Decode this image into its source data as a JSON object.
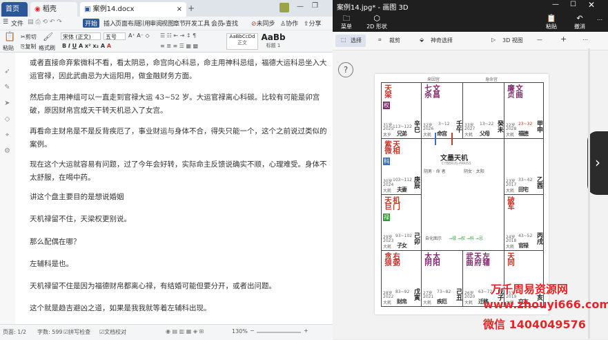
{
  "wps": {
    "tabs": [
      {
        "label": "首页"
      },
      {
        "label": "稻壳"
      },
      {
        "label": "案例14.docx"
      }
    ],
    "menus": [
      "文件",
      "开始",
      "插入",
      "页面布局",
      "引用",
      "审阅",
      "视图",
      "章节",
      "开发工具"
    ],
    "menu_more": "会员",
    "search_label": "查找",
    "sync_label": "未同步",
    "collab_label": "协作",
    "share_label": "分享",
    "ribbon": {
      "paste": "粘贴",
      "cut": "剪切",
      "copy": "复制",
      "format_painter": "格式刷",
      "font_name": "宋体 (正文)",
      "font_size": "五号",
      "style_normal_preview": "AaBbCcDd",
      "style_normal": "正文",
      "style_heading_preview": "AaBb",
      "style_heading": "标题 1"
    },
    "paragraphs": [
      "或者直接命弃紫微科不看，看太阴忌，命宫向心科忌，命主用神科忌组，福德大运科忌坐入大运官禄，因此武曲忌为大运阳用，做金融财务方面。",
      "然后命主用神组可以一直走到官禄大运 43~52 岁。大运官禄离心科碳。比较有可能是卯宫破，原因财帛宫成天干转天机忌入了女宫。",
      "再看命主财帛是不是反背疾厄了，事业财运与身体不合，得失只能一个，这个之前说过类似的案例。",
      "现在这个大运就容易有问题，过了今年会好转，实际命主反馈说确实不顺，心理难受。身体不太舒服，在喝中药。",
      "讲这个盘主要目的是想说婚姻",
      "天机禄留不住，天梁权更别说。",
      "那么配偶在哪？",
      "左辅科是也。",
      "天机禄留不住是因为福德财帛都离心禄，有结婚可能但要分开，或者出问题。",
      "这个就是趋吉避凶之道，如果是我我就等着左辅科出现。"
    ],
    "status": {
      "page": "页面: 1/2",
      "words": "字数: 599",
      "spell": "拼写检查",
      "proof": "文档校对",
      "zoom": "130%"
    }
  },
  "paint3d": {
    "title": "案例14.jpg* - 画图 3D",
    "toolbar": {
      "menu": "菜单",
      "shapes": "2D 形状",
      "paste": "粘贴",
      "undo": "撤消"
    },
    "subtools": {
      "select": "选择",
      "crop": "裁剪",
      "magic_select": "神奇选择",
      "view_3d": "3D 视图"
    },
    "help_label": "?",
    "chart": {
      "top_left_label": "来因宫",
      "top_right_label": "身命宫",
      "center_title": "文墨天机",
      "center_subtitle": "CYBERUS-PARISS",
      "center_info_left": "阴男 · 命 者",
      "center_info_right": "阴女 · 太阳",
      "flying_line": "自化图示",
      "flying_legend": "→禄 →权 →科 →忌",
      "palaces": [
        {
          "stars": [
            "天梁"
          ],
          "hua": "权",
          "hua_color": "#7d2a6a",
          "age": "31岁",
          "year": "2025",
          "range": "113~122",
          "name": "兄弟",
          "gan": "辛巳",
          "sub": "太岁"
        },
        {
          "stars": [
            "七杀",
            "文昌"
          ],
          "hua": "",
          "hua_color": "",
          "age": "32岁",
          "year": "2026",
          "range": "3~12",
          "name": "命宫",
          "gan": "壬午",
          "sub": "大耗"
        },
        {
          "stars": [],
          "hua": "",
          "hua_color": "",
          "age": "33岁",
          "year": "2027",
          "range": "13~22",
          "name": "父母",
          "gan": "癸未",
          "sub": "大耗"
        },
        {
          "stars": [
            "廉贞",
            "文曲"
          ],
          "hua": "",
          "hua_color": "",
          "age": "22岁",
          "year": "2028",
          "range": "23~32",
          "name": "福德",
          "gan": "甲申",
          "sub": "大耗"
        },
        {
          "stars": [
            "紫微",
            "天相"
          ],
          "hua": "科",
          "hua_color": "#3a6fb5",
          "age": "30岁",
          "year": "2024",
          "range": "103~112",
          "name": "夫妻",
          "gan": "庚辰",
          "sub": "大耗"
        },
        {
          "stars": [],
          "hua": "",
          "hua_color": "",
          "age": "23岁",
          "year": "2017",
          "range": "33~42",
          "name": "田宅",
          "gan": "乙酉",
          "sub": "大耗"
        },
        {
          "stars": [
            "天巨",
            "机门"
          ],
          "hua": "禄",
          "hua_color": "#2e9b3e",
          "age": "29岁",
          "year": "2023",
          "range": "93~102",
          "name": "子女",
          "gan": "己卯",
          "sub": "大耗"
        },
        {
          "stars": [
            "破军"
          ],
          "hua": "",
          "hua_color": "",
          "age": "24岁",
          "year": "2018",
          "range": "43~52",
          "name": "官禄",
          "gan": "丙戌",
          "sub": "大耗"
        },
        {
          "stars": [
            "贪狼",
            "右弼"
          ],
          "hua": "",
          "hua_color": "",
          "age": "28岁",
          "year": "2022",
          "range": "83~92",
          "name": "财帛",
          "gan": "戊寅",
          "sub": "大耗"
        },
        {
          "stars": [
            "太阴",
            "太阳"
          ],
          "hua": "",
          "hua_color": "",
          "age": "27岁",
          "year": "2021",
          "range": "73~82",
          "name": "疾厄",
          "gan": "己丑",
          "sub": "大耗"
        },
        {
          "stars": [
            "武曲",
            "天府",
            "左辅"
          ],
          "hua": "",
          "hua_color": "",
          "age": "26岁",
          "year": "2020",
          "range": "63~72",
          "name": "迁移",
          "gan": "戊子",
          "sub": "大耗"
        },
        {
          "stars": [
            "天同"
          ],
          "hua": "",
          "hua_color": "",
          "age": "25岁",
          "year": "2019",
          "range": "53~62",
          "name": "交友",
          "gan": "丁亥",
          "sub": "大耗"
        }
      ]
    }
  },
  "watermark": {
    "line1": "万千周易资源网",
    "line2": "www.zhouyi666.com",
    "line3": "微信 1404049576"
  },
  "colors": {
    "wps_accent": "#2b579a",
    "paint_dark": "#1f1f1f",
    "star_red": "#c0392b",
    "watermark_red": "#e0282c"
  }
}
